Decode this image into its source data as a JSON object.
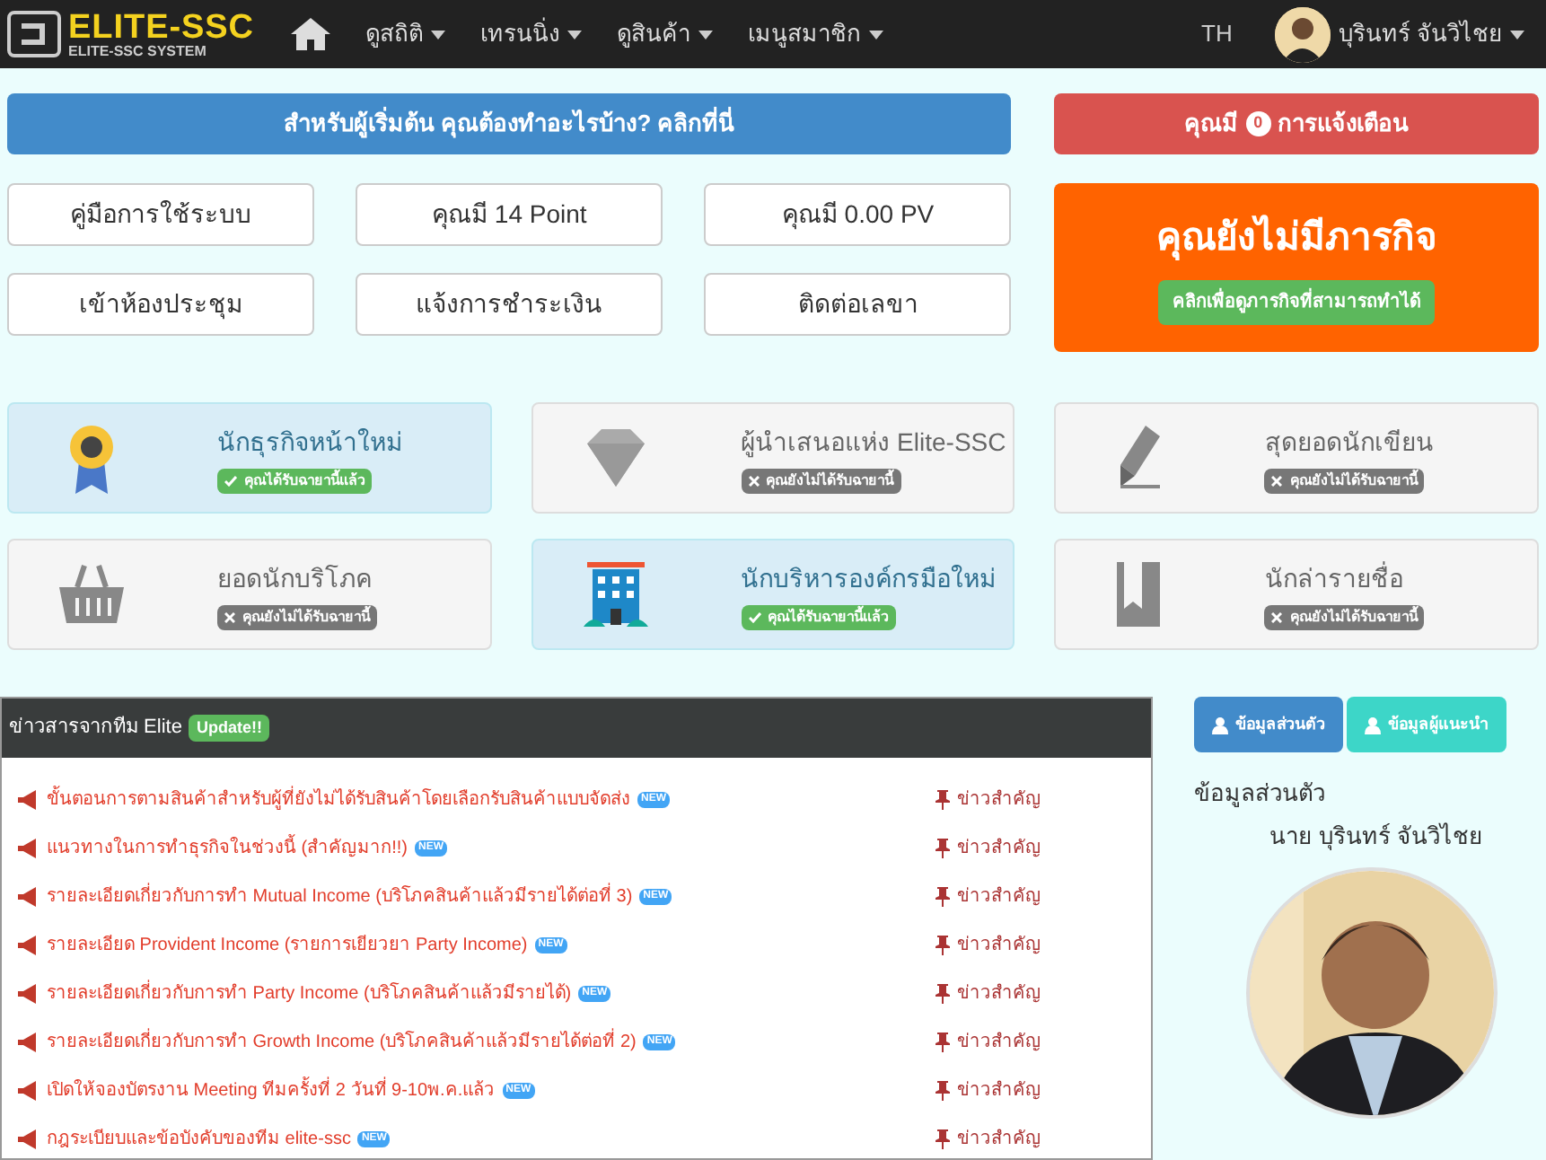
{
  "navbar": {
    "logo_title": "ELITE-SSC",
    "logo_subtitle": "ELITE-SSC SYSTEM",
    "menus": [
      "ดูสถิติ",
      "เทรนนิ่ง",
      "ดูสินค้า",
      "เมนูสมาชิก"
    ],
    "language": "TH",
    "user_name": "บุรินทร์ จันวิไชย"
  },
  "beginner_button": "สำหรับผู้เริ่มต้น คุณต้องทำอะไรบ้าง? คลิกที่นี่",
  "notifications": {
    "prefix": "คุณมี",
    "count": "0",
    "suffix": "การแจ้งเตือน"
  },
  "quick_buttons": [
    "คู่มือการใช้ระบบ",
    "คุณมี 14 Point",
    "คุณมี 0.00 PV",
    "เข้าห้องประชุม",
    "แจ้งการชำระเงิน",
    "ติดต่อเลขา"
  ],
  "mission": {
    "title": "คุณยังไม่มีภารกิจ",
    "button": "คลิกเพื่อดูภารกิจที่สามารถทำได้"
  },
  "titles": [
    {
      "kind": "ribbon",
      "name": "นักธุรกิจหน้าใหม่",
      "earned": true,
      "status": "คุณได้รับฉายานี้แล้ว"
    },
    {
      "kind": "diamond",
      "name": "ผู้นำเสนอแห่ง Elite-SSC",
      "earned": false,
      "status": "คุณยังไม่ได้รับฉายานี้"
    },
    {
      "kind": "pen",
      "name": "สุดยอดนักเขียน",
      "earned": false,
      "status": "คุณยังไม่ได้รับฉายานี้"
    },
    {
      "kind": "basket",
      "name": "ยอดนักบริโภค",
      "earned": false,
      "status": "คุณยังไม่ได้รับฉายานี้"
    },
    {
      "kind": "building",
      "name": "นักบริหารองค์กรมือใหม่",
      "earned": true,
      "status": "คุณได้รับฉายานี้แล้ว"
    },
    {
      "kind": "bookmark",
      "name": "นักล่ารายชื่อ",
      "earned": false,
      "status": "คุณยังไม่ได้รับฉายานี้"
    }
  ],
  "news": {
    "title": "ข่าวสารจากทีม Elite",
    "badge": "Update!!",
    "items": [
      {
        "title": "ขั้นตอนการตามสินค้าสำหรับผู้ที่ยังไม่ได้รับสินค้าโดยเลือกรับสินค้าแบบจัดส่ง",
        "is_new": true,
        "new_label": "NEW",
        "tag": "ข่าวสำคัญ"
      },
      {
        "title": "แนวทางในการทำธุรกิจในช่วงนี้ (สำคัญมาก!!)",
        "is_new": true,
        "new_label": "NEW",
        "tag": "ข่าวสำคัญ"
      },
      {
        "title": "รายละเอียดเกี่ยวกับการทำ Mutual Income (บริโภคสินค้าแล้วมีรายได้ต่อที่ 3)",
        "is_new": true,
        "new_label": "NEW",
        "tag": "ข่าวสำคัญ"
      },
      {
        "title": "รายละเอียด Provident Income (รายการเยียวยา Party Income)",
        "is_new": true,
        "new_label": "NEW",
        "tag": "ข่าวสำคัญ"
      },
      {
        "title": "รายละเอียดเกี่ยวกับการทำ Party Income (บริโภคสินค้าแล้วมีรายได้)",
        "is_new": true,
        "new_label": "NEW",
        "tag": "ข่าวสำคัญ"
      },
      {
        "title": "รายละเอียดเกี่ยวกับการทำ Growth Income (บริโภคสินค้าแล้วมีรายได้ต่อที่ 2)",
        "is_new": true,
        "new_label": "NEW",
        "tag": "ข่าวสำคัญ"
      },
      {
        "title": "เปิดให้จองบัตรงาน Meeting ทีมครั้งที่ 2 วันที่ 9-10พ.ค.แล้ว",
        "is_new": true,
        "new_label": "NEW",
        "tag": "ข่าวสำคัญ"
      },
      {
        "title": "กฎระเบียบและข้อบังคับของทีม elite-ssc",
        "is_new": true,
        "new_label": "NEW",
        "tag": "ข่าวสำคัญ"
      }
    ]
  },
  "profile": {
    "tabs": [
      {
        "label": "ข้อมูลส่วนตัว",
        "selected": true
      },
      {
        "label": "ข้อมูลผู้แนะนำ",
        "selected": false
      }
    ],
    "heading": "ข้อมูลส่วนตัว",
    "name": "นาย บุรินทร์ จันวิไชย"
  }
}
